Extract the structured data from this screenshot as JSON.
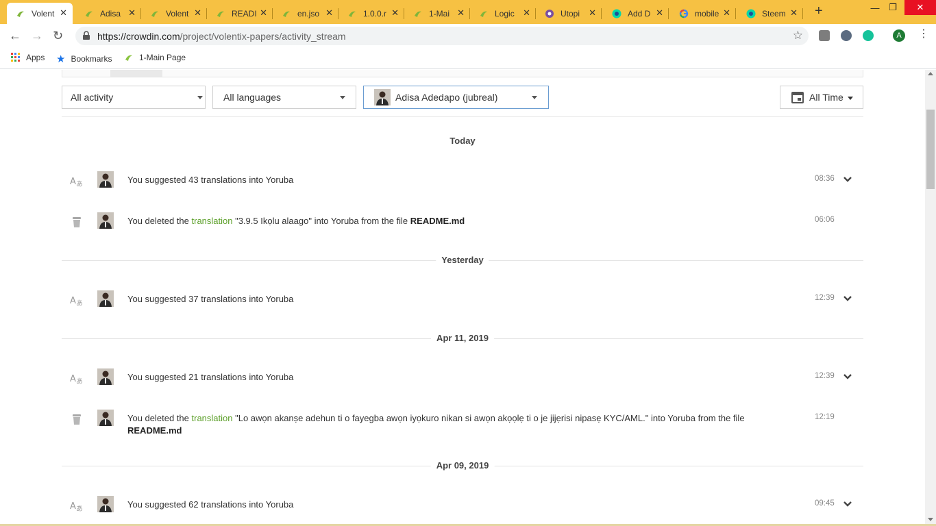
{
  "browser": {
    "tabs": [
      {
        "label": "Volent",
        "favicon": "crowdin-icon",
        "active": true
      },
      {
        "label": "Adisa",
        "favicon": "crowdin-icon",
        "active": false
      },
      {
        "label": "Volent",
        "favicon": "crowdin-icon",
        "active": false
      },
      {
        "label": "READI",
        "favicon": "crowdin-icon",
        "active": false
      },
      {
        "label": "en.jso",
        "favicon": "crowdin-icon",
        "active": false
      },
      {
        "label": "1.0.0.r",
        "favicon": "crowdin-icon",
        "active": false
      },
      {
        "label": "1-Mai",
        "favicon": "crowdin-icon",
        "active": false
      },
      {
        "label": "Logic",
        "favicon": "crowdin-icon",
        "active": false
      },
      {
        "label": "Utopi",
        "favicon": "utopian-icon",
        "active": false
      },
      {
        "label": "Add D",
        "favicon": "steemit-icon",
        "active": false
      },
      {
        "label": "mobile",
        "favicon": "google-icon",
        "active": false
      },
      {
        "label": "Steem",
        "favicon": "steemit-icon",
        "active": false
      }
    ],
    "url_host": "https://crowdin.com",
    "url_path": "/project/volentix-papers/activity_stream",
    "profile_initial": "A",
    "bookmarks": [
      {
        "label": "Apps",
        "icon": "apps-grid-icon"
      },
      {
        "label": "Bookmarks",
        "icon": "star-icon"
      },
      {
        "label": "1-Main Page",
        "icon": "crowdin-icon"
      }
    ],
    "colors": {
      "tabbar": "#f6c143",
      "close": "#e81123"
    }
  },
  "filters": {
    "activity": "All activity",
    "languages": "All languages",
    "user": "Adisa Adedapo (jubreal)",
    "time": "All Time"
  },
  "groups": [
    {
      "date": "Today",
      "items": [
        {
          "type": "suggest",
          "icon": "translate-icon",
          "text_plain": "You suggested 43 translations into Yoruba",
          "time": "08:36",
          "expandable": true
        },
        {
          "type": "delete",
          "icon": "trash-icon",
          "pre": "You deleted the ",
          "link": "translation",
          "mid": " \"3.9.5 Ikọlu alaago\" into Yoruba from the file ",
          "file": "README.md",
          "time": "06:06",
          "expandable": false
        }
      ]
    },
    {
      "date": "Yesterday",
      "items": [
        {
          "type": "suggest",
          "icon": "translate-icon",
          "text_plain": "You suggested 37 translations into Yoruba",
          "time": "12:39",
          "expandable": true
        }
      ]
    },
    {
      "date": "Apr 11, 2019",
      "items": [
        {
          "type": "suggest",
          "icon": "translate-icon",
          "text_plain": "You suggested 21 translations into Yoruba",
          "time": "12:39",
          "expandable": true
        },
        {
          "type": "delete",
          "icon": "trash-icon",
          "pre": "You deleted the ",
          "link": "translation",
          "mid": " \"Lo awọn akanṣe adehun ti o fayegba awọn iyọkuro nikan si awọn akọọlẹ ti o je jijẹrisi nipasẹ KYC/AML.\" into Yoruba from the file ",
          "file": "README.md",
          "time": "12:19",
          "expandable": false
        }
      ]
    },
    {
      "date": "Apr 09, 2019",
      "items": [
        {
          "type": "suggest",
          "icon": "translate-icon",
          "text_plain": "You suggested 62 translations into Yoruba",
          "time": "09:45",
          "expandable": true
        }
      ]
    }
  ],
  "accent_green": "#5b9f28"
}
